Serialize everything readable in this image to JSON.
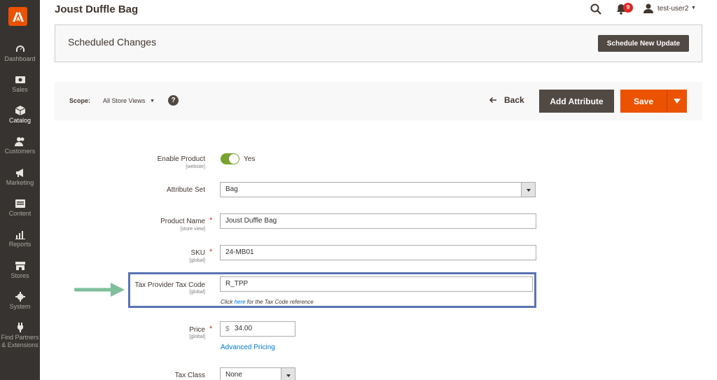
{
  "sidebar": {
    "items": [
      {
        "label": "Dashboard",
        "icon": "dashboard-icon"
      },
      {
        "label": "Sales",
        "icon": "sales-icon"
      },
      {
        "label": "Catalog",
        "icon": "catalog-icon"
      },
      {
        "label": "Customers",
        "icon": "customers-icon"
      },
      {
        "label": "Marketing",
        "icon": "marketing-icon"
      },
      {
        "label": "Content",
        "icon": "content-icon"
      },
      {
        "label": "Reports",
        "icon": "reports-icon"
      },
      {
        "label": "Stores",
        "icon": "stores-icon"
      },
      {
        "label": "System",
        "icon": "system-icon"
      },
      {
        "label": "Find Partners\n& Extensions",
        "icon": "extensions-icon"
      }
    ]
  },
  "header": {
    "title": "Joust Duffle Bag",
    "notification_count": "9",
    "username": "test-user2"
  },
  "scheduled": {
    "title": "Scheduled Changes",
    "button": "Schedule New Update"
  },
  "actionbar": {
    "scope_label": "Scope:",
    "scope_value": "All Store Views",
    "help": "?",
    "back": "Back",
    "add_attribute": "Add Attribute",
    "save": "Save"
  },
  "form": {
    "enable_product": {
      "label": "Enable Product",
      "scope": "[website]",
      "value": "Yes"
    },
    "attribute_set": {
      "label": "Attribute Set",
      "value": "Bag"
    },
    "product_name": {
      "label": "Product Name",
      "scope": "[store view]",
      "value": "Joust Duffle Bag"
    },
    "sku": {
      "label": "SKU",
      "scope": "[global]",
      "value": "24-MB01"
    },
    "tax_code": {
      "label": "Tax Provider Tax Code",
      "scope": "[global]",
      "value": "R_TPP",
      "hint_pre": "Click ",
      "hint_link": "here",
      "hint_post": " for the Tax Code reference"
    },
    "price": {
      "label": "Price",
      "scope": "[global]",
      "currency": "$",
      "value": "34.00",
      "advanced": "Advanced Pricing"
    },
    "tax_class": {
      "label": "Tax Class",
      "value": "None"
    }
  },
  "colors": {
    "sidebar": "#373330",
    "accent": "#eb5202",
    "highlight": "#5b73b3",
    "arrow": "#7fbf9c"
  }
}
